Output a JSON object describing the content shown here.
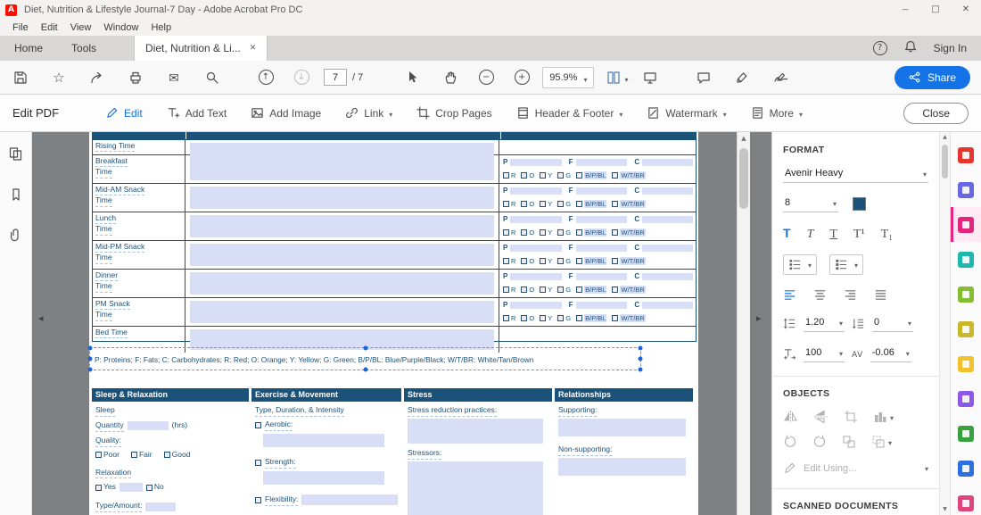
{
  "colors": {
    "accent_blue": "#1473e6",
    "table_navy": "#1a527a",
    "field_lavender": "#d9def7",
    "active_tool_pink": "#e5257d",
    "share_button_blue": "#1473e6"
  },
  "titlebar": {
    "title": "Diet, Nutrition & Lifestyle Journal-7 Day - Adobe Acrobat Pro DC"
  },
  "menubar": {
    "items": [
      "File",
      "Edit",
      "View",
      "Window",
      "Help"
    ]
  },
  "tabbar": {
    "home": "Home",
    "tools": "Tools",
    "document": "Diet, Nutrition & Li...",
    "sign_in": "Sign In"
  },
  "toolbar": {
    "page_current": "7",
    "page_total": "/ 7",
    "zoom": "95.9%",
    "share": "Share"
  },
  "editbar": {
    "title": "Edit PDF",
    "items": [
      {
        "label": "Edit"
      },
      {
        "label": "Add Text"
      },
      {
        "label": "Add Image"
      },
      {
        "label": "Link"
      },
      {
        "label": "Crop Pages"
      },
      {
        "label": "Header & Footer"
      },
      {
        "label": "Watermark"
      },
      {
        "label": "More"
      }
    ],
    "close": "Close"
  },
  "form": {
    "meal_rows": [
      {
        "line1": "Rising Time",
        "line2": "",
        "pfc": false
      },
      {
        "line1": "Breakfast",
        "line2": "Time",
        "pfc": true
      },
      {
        "line1": "Mid-AM Snack",
        "line2": "Time",
        "pfc": true
      },
      {
        "line1": "Lunch",
        "line2": "Time",
        "pfc": true
      },
      {
        "line1": "Mid-PM Snack",
        "line2": "Time",
        "pfc": true
      },
      {
        "line1": "Dinner",
        "line2": "Time",
        "pfc": true
      },
      {
        "line1": "PM Snack",
        "line2": "Time",
        "pfc": true
      },
      {
        "line1": "Bed Time",
        "line2": "",
        "pfc": false
      }
    ],
    "pfc_labels": [
      "P",
      "F",
      "C"
    ],
    "color_checkboxes": [
      "R",
      "O",
      "Y",
      "G",
      "B/P/BL",
      "W/T/BR"
    ],
    "legend": "P: Proteins; F: Fats; C: Carbohydrates; R: Red; O: Orange; Y: Yellow; G: Green; B/P/BL: Blue/Purple/Black; W/T/BR: White/Tan/Brown",
    "lifestyle": {
      "headers": [
        "Sleep & Relaxation",
        "Exercise & Movement",
        "Stress",
        "Relationships"
      ],
      "sleep": {
        "label": "Sleep",
        "quantity_label": "Quantity",
        "hrs": "(hrs)",
        "quality_label": "Quality:",
        "quality_options": [
          "Poor",
          "Fair",
          "Good"
        ],
        "relaxation_label": "Relaxation",
        "yes": "Yes",
        "no": "No",
        "type_amount": "Type/Amount:"
      },
      "exercise": {
        "label": "Type, Duration, & Intensity",
        "items": [
          "Aerobic:",
          "Strength:",
          "Flexibility:"
        ]
      },
      "stress": {
        "practices_label": "Stress reduction practices:",
        "stressors_label": "Stressors:"
      },
      "relationships": {
        "supporting_label": "Supporting:",
        "non_supporting_label": "Non-supporting:"
      }
    }
  },
  "format_panel": {
    "header": "FORMAT",
    "font_name": "Avenir Heavy",
    "font_size": "8",
    "line_spacing": "1.20",
    "paragraph_spacing": "0",
    "horizontal_scale": "100",
    "character_spacing": "-0.06",
    "objects_header": "OBJECTS",
    "edit_using": "Edit Using...",
    "scanned_header": "SCANNED DOCUMENTS"
  },
  "tools_rail": {
    "tools": [
      {
        "name": "export-pdf",
        "color": "#e4362c",
        "active": false
      },
      {
        "name": "organize-pages",
        "color": "#6a67e6",
        "active": false
      },
      {
        "name": "edit-pdf",
        "color": "#e5257d",
        "active": true
      },
      {
        "name": "create-pdf",
        "color": "#1fb8ae",
        "active": false
      },
      {
        "name": "combine-files",
        "color": "#84bd30",
        "active": false
      },
      {
        "name": "compress-pdf",
        "color": "#c9b72a",
        "active": false
      },
      {
        "name": "comment",
        "color": "#f2c12e",
        "active": false
      },
      {
        "name": "fill-sign",
        "color": "#8d57e8",
        "active": false
      },
      {
        "name": "request-signatures",
        "color": "#3aa13f",
        "active": false
      },
      {
        "name": "protect",
        "color": "#2d6fe0",
        "active": false
      },
      {
        "name": "more-tools",
        "color": "#e0447c",
        "active": false
      }
    ]
  }
}
